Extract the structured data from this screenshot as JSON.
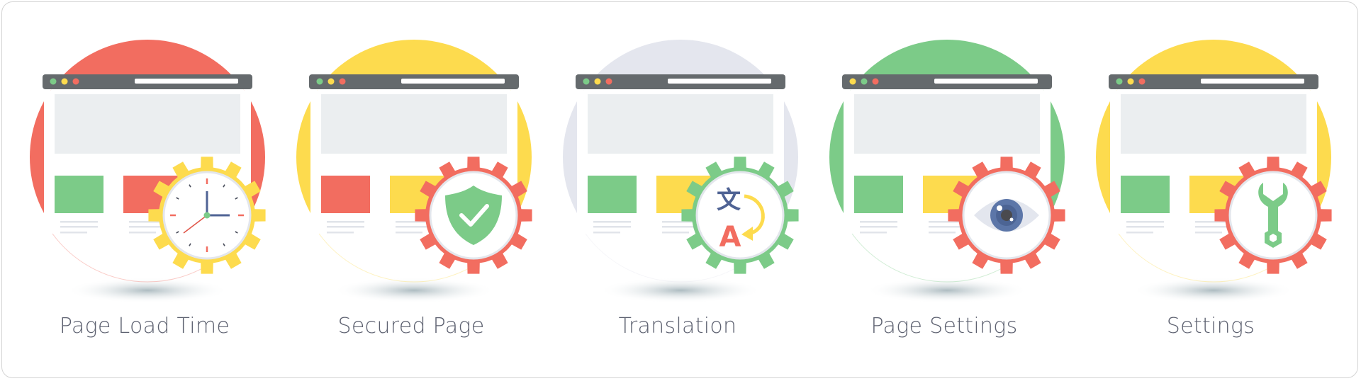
{
  "items": [
    {
      "label": "Page Load Time",
      "icon": "clock-icon",
      "circle_color": "#f26d60",
      "gear_color": "#fddb4e",
      "dots": [
        "#7ccb88",
        "#fddb4e",
        "#f26d60"
      ],
      "blocks": [
        "#7ccb88",
        "#f26d60"
      ]
    },
    {
      "label": "Secured Page",
      "icon": "shield-check-icon",
      "circle_color": "#fddb4e",
      "gear_color": "#f26d60",
      "dots": [
        "#7ccb88",
        "#fddb4e",
        "#f26d60"
      ],
      "blocks": [
        "#f26d60",
        "#fddb4e"
      ]
    },
    {
      "label": "Translation",
      "icon": "translate-icon",
      "circle_color": "#e4e6ee",
      "gear_color": "#7ccb88",
      "dots": [
        "#7ccb88",
        "#fddb4e",
        "#f26d60"
      ],
      "blocks": [
        "#7ccb88",
        "#fddb4e"
      ],
      "glyph_top": "文",
      "glyph_bottom": "A"
    },
    {
      "label": "Page Settings",
      "icon": "eye-icon",
      "circle_color": "#7ccb88",
      "gear_color": "#f26d60",
      "dots": [
        "#fddb4e",
        "#7ccb88",
        "#f26d60"
      ],
      "blocks": [
        "#7ccb88",
        "#fddb4e"
      ]
    },
    {
      "label": "Settings",
      "icon": "wrench-icon",
      "circle_color": "#fddb4e",
      "gear_color": "#f26d60",
      "dots": [
        "#7ccb88",
        "#fddb4e",
        "#f26d60"
      ],
      "blocks": [
        "#7ccb88",
        "#fddb4e"
      ]
    }
  ],
  "colors": {
    "browser_bar": "#656a6d",
    "content_gray": "#ebeef0",
    "lines_gray": "#e1e4ea",
    "text": "#5d6170",
    "navy": "#4f6394"
  }
}
